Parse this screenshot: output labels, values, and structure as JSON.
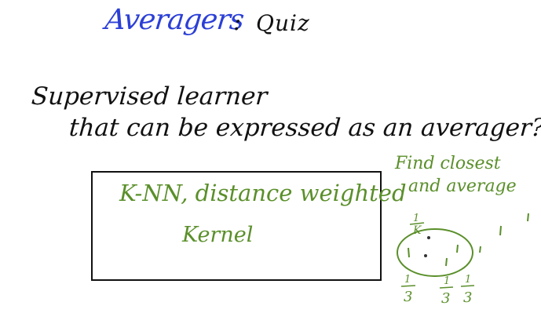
{
  "title": {
    "main": "Averagers",
    "separator": ":",
    "sub": "Quiz"
  },
  "question": {
    "line1": "Supervised learner",
    "line2": "that can be expressed as an averager?"
  },
  "answer": {
    "line1": "K-NN, distance weighted",
    "line2": "Kernel"
  },
  "side_note": {
    "line1": "Find closest",
    "line2": "and average"
  },
  "diagram": {
    "top_fraction": {
      "numerator": "1",
      "denominator": "K"
    },
    "bottom_fractions": [
      {
        "numerator": "1",
        "denominator": "3"
      },
      {
        "numerator": "1",
        "denominator": "3"
      },
      {
        "numerator": "1",
        "denominator": "3"
      }
    ]
  },
  "colors": {
    "title_blue": "#2b3fd6",
    "ink_black": "#111111",
    "answer_green": "#5a8f2a"
  }
}
